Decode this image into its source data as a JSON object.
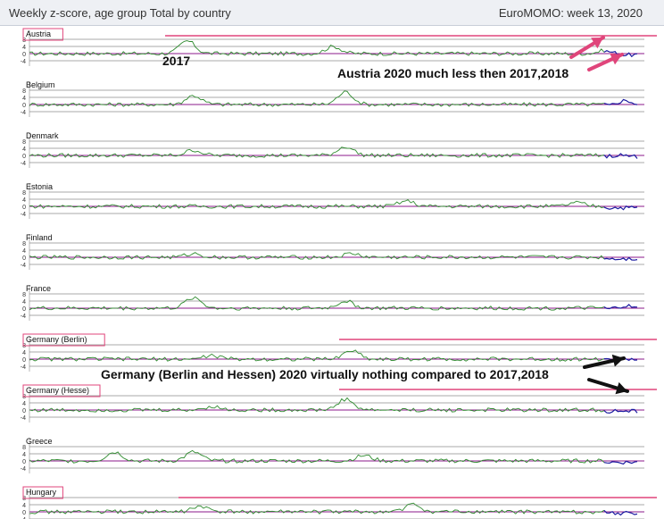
{
  "header": {
    "title": "Weekly z-score, age group Total by country",
    "source": "EuroMOMO: week 13, 2020"
  },
  "annotations": {
    "year_2017": "2017",
    "austria_note": "Austria 2020 much less then 2017,2018",
    "germany_note": "Germany (Berlin and Hessen) 2020 virtually nothing compared to 2017,2018"
  },
  "colors": {
    "series_line": "#2e8b2e",
    "series_2020": "#1a1aa0",
    "baseline": "#8b1a8b",
    "gridline": "#555555",
    "highlight": "#e0457b",
    "arrow_black": "#111111"
  },
  "chart_data": {
    "type": "line",
    "title": "Weekly z-score, age group Total by country",
    "x_range": [
      "2016",
      "2020 week 13"
    ],
    "ylim": [
      -4,
      10
    ],
    "y_ticks": [
      "8",
      "4",
      "0",
      "-4"
    ],
    "series": [
      {
        "name": "Austria",
        "highlighted": true,
        "peaks": [
          [
            0.26,
            7
          ],
          [
            0.5,
            4
          ],
          [
            0.95,
            2
          ]
        ]
      },
      {
        "name": "Belgium",
        "highlighted": false,
        "peaks": [
          [
            0.27,
            5
          ],
          [
            0.52,
            7
          ],
          [
            0.98,
            3
          ]
        ]
      },
      {
        "name": "Denmark",
        "highlighted": false,
        "peaks": [
          [
            0.27,
            3
          ],
          [
            0.52,
            5
          ],
          [
            0.97,
            1
          ]
        ]
      },
      {
        "name": "Estonia",
        "highlighted": false,
        "peaks": [
          [
            0.62,
            3
          ],
          [
            0.9,
            2
          ]
        ]
      },
      {
        "name": "Finland",
        "highlighted": false,
        "peaks": [
          [
            0.27,
            2
          ],
          [
            0.53,
            2
          ]
        ]
      },
      {
        "name": "France",
        "highlighted": false,
        "peaks": [
          [
            0.27,
            6
          ],
          [
            0.52,
            4
          ],
          [
            0.98,
            2
          ]
        ]
      },
      {
        "name": "Germany (Berlin)",
        "highlighted": true,
        "peaks": [
          [
            0.3,
            2
          ],
          [
            0.53,
            5
          ],
          [
            0.98,
            1
          ]
        ]
      },
      {
        "name": "Germany (Hesse)",
        "highlighted": true,
        "peaks": [
          [
            0.3,
            2
          ],
          [
            0.52,
            6
          ]
        ]
      },
      {
        "name": "Greece",
        "highlighted": false,
        "peaks": [
          [
            0.14,
            5
          ],
          [
            0.27,
            5
          ],
          [
            0.55,
            3
          ]
        ]
      },
      {
        "name": "Hungary",
        "highlighted": true,
        "peaks": [
          [
            0.28,
            3
          ],
          [
            0.63,
            4
          ]
        ]
      }
    ]
  }
}
